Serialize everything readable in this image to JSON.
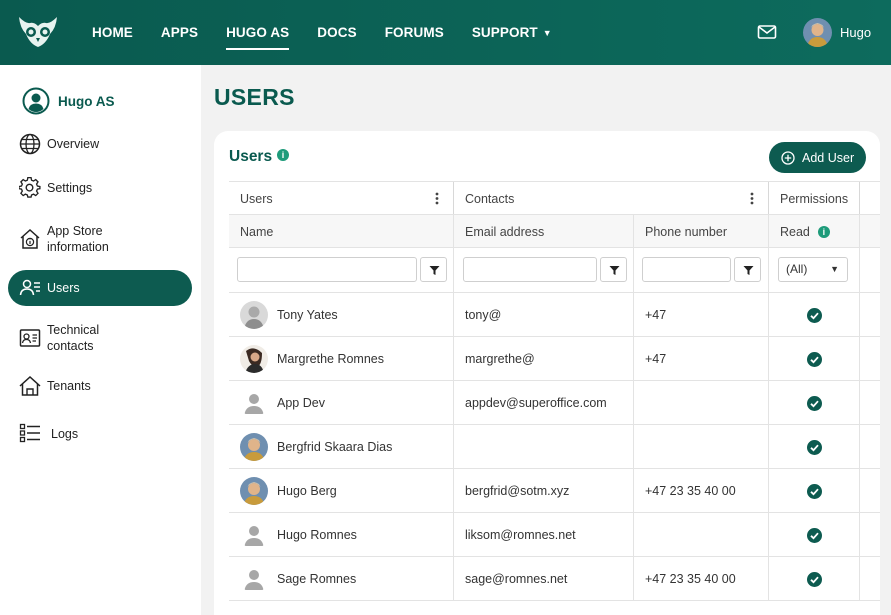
{
  "nav": {
    "items": [
      {
        "label": "HOME"
      },
      {
        "label": "APPS"
      },
      {
        "label": "HUGO AS"
      },
      {
        "label": "DOCS"
      },
      {
        "label": "FORUMS"
      },
      {
        "label": "SUPPORT"
      }
    ],
    "active": "HUGO AS",
    "user_name": "Hugo"
  },
  "sidebar": {
    "header": "Hugo AS",
    "items": [
      {
        "label": "Overview",
        "icon": "globe-icon"
      },
      {
        "label": "Settings",
        "icon": "gear-icon"
      },
      {
        "label": "App Store information",
        "icon": "home-info-icon"
      },
      {
        "label": "Users",
        "icon": "users-icon"
      },
      {
        "label": "Technical contacts",
        "icon": "contact-card-icon"
      },
      {
        "label": "Tenants",
        "icon": "tenants-icon"
      },
      {
        "label": "Logs",
        "icon": "list-icon"
      }
    ],
    "active": "Users"
  },
  "page": {
    "title": "USERS"
  },
  "card": {
    "title": "Users",
    "info": "i",
    "add_button": "Add User"
  },
  "grid": {
    "groups": [
      "Users",
      "Contacts",
      "Permissions"
    ],
    "columns": [
      "Name",
      "Email address",
      "Phone number",
      "Read"
    ],
    "filter_select": "(All)",
    "rows": [
      {
        "name": "Tony Yates",
        "email": "tony@",
        "phone": "+47",
        "avatar": "photo-gray"
      },
      {
        "name": "Margrethe Romnes",
        "email": "margrethe@",
        "phone": "+47",
        "avatar": "photo-dark"
      },
      {
        "name": "App Dev",
        "email": "appdev@superoffice.com",
        "phone": "",
        "avatar": "placeholder"
      },
      {
        "name": "Bergfrid Skaara Dias",
        "email": "",
        "phone": "",
        "avatar": "photo-color"
      },
      {
        "name": "Hugo Berg",
        "email": "bergfrid@sotm.xyz",
        "phone": "+47 23 35 40 00",
        "avatar": "photo-color"
      },
      {
        "name": "Hugo Romnes",
        "email": "liksom@romnes.net",
        "phone": "",
        "avatar": "placeholder"
      },
      {
        "name": "Sage Romnes",
        "email": "sage@romnes.net",
        "phone": "+47 23 35 40 00",
        "avatar": "placeholder"
      }
    ]
  },
  "colors": {
    "brand": "#0a5a4f",
    "accent": "#1e9b7a",
    "background": "#f2f2f2"
  }
}
